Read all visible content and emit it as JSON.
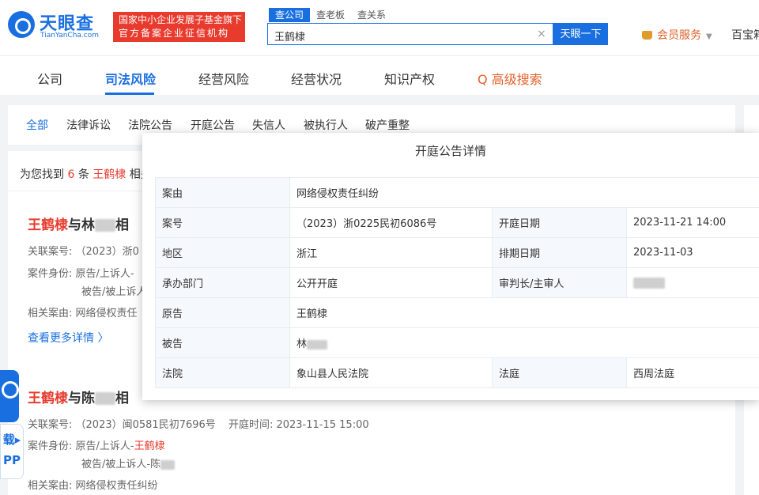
{
  "header": {
    "logo_name": "天眼查",
    "logo_sub": "TianYanCha.com",
    "slogan_line1": "国家中小企业发展子基金旗下",
    "slogan_line2": "官方备案企业征信机构",
    "search_tabs": [
      "查公司",
      "查老板",
      "查关系"
    ],
    "search_value": "王鹤棣",
    "search_clear": "×",
    "search_button": "天眼一下",
    "member": "会员服务",
    "member_arrow": "▼",
    "baibao": "百宝箱"
  },
  "mainnav": {
    "items": [
      "公司",
      "司法风险",
      "经营风险",
      "经营状况",
      "知识产权"
    ],
    "advanced": "Q 高级搜索"
  },
  "subtabs": [
    "全部",
    "法律诉讼",
    "法院公告",
    "开庭公告",
    "失信人",
    "被执行人",
    "破产重整"
  ],
  "results": {
    "prefix": "为您找到",
    "count": "6",
    "unit": "条",
    "keyword": "王鹤棣",
    "suffix": "相关"
  },
  "cases": [
    {
      "title_hl": "王鹤棣",
      "title_mid": "与林",
      "title_tail": "相",
      "related_case_label": "关联案号:",
      "related_case_value": "（2023）浙0",
      "role_label": "案件身份:",
      "role_line1": "原告/上诉人-",
      "role_line2": "被告/被上诉人-",
      "cause_label": "相关案由:",
      "cause_value": "网络侵权责任",
      "more": "查看更多详情 〉"
    },
    {
      "title_hl": "王鹤棣",
      "title_mid": "与陈",
      "title_tail": "相",
      "related_case_label": "关联案号:",
      "related_case_value": "（2023）闽0581民初7696号",
      "time_label": "开庭时间:",
      "time_value": "2023-11-15 15:00",
      "role_label": "案件身份:",
      "role_line1": "原告/上诉人-",
      "role_line1_hl": "王鹤棣",
      "role_line2": "被告/被上诉人-陈",
      "cause_label": "相关案由:",
      "cause_value": "网络侵权责任纠纷"
    }
  ],
  "app_widget_text": "载▸ PP",
  "modal": {
    "title": "开庭公告详情",
    "rows": [
      {
        "l1": "案由",
        "v1": "网络侵权责任纠纷"
      },
      {
        "l1": "案号",
        "v1": "（2023）浙0225民初6086号",
        "l2": "开庭日期",
        "v2": "2023-11-21 14:00"
      },
      {
        "l1": "地区",
        "v1": "浙江",
        "l2": "排期日期",
        "v2": "2023-11-03"
      },
      {
        "l1": "承办部门",
        "v1": "公开开庭",
        "l2": "审判长/主审人",
        "v2": ""
      },
      {
        "l1": "原告",
        "v1": "王鹤棣"
      },
      {
        "l1": "被告",
        "v1": "林"
      },
      {
        "l1": "法院",
        "v1": "象山县人民法院",
        "l2": "法庭",
        "v2": "西周法庭"
      }
    ]
  }
}
